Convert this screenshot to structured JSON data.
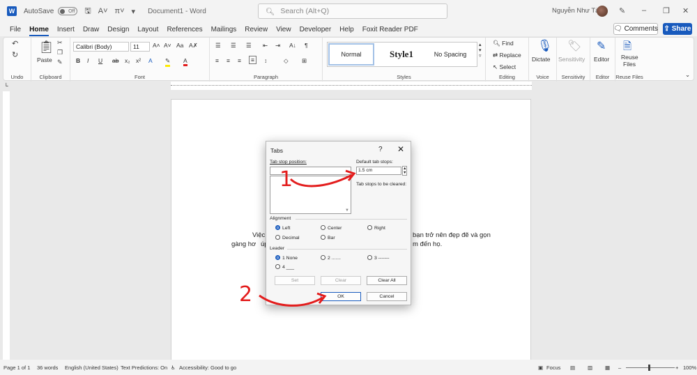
{
  "titlebar": {
    "autosave_label": "AutoSave",
    "autosave_state": "Off",
    "document_title": "Document1 - Word",
    "search_placeholder": "Search (Alt+Q)",
    "user_name": "Nguyễn Như Tài"
  },
  "menu": {
    "tabs": [
      "File",
      "Home",
      "Insert",
      "Draw",
      "Design",
      "Layout",
      "References",
      "Mailings",
      "Review",
      "View",
      "Developer",
      "Help",
      "Foxit Reader PDF"
    ],
    "active_tab": "Home",
    "comments_label": "Comments",
    "share_label": "Share"
  },
  "ribbon": {
    "undo_label": "Undo",
    "clipboard": {
      "paste": "Paste",
      "label": "Clipboard"
    },
    "font": {
      "name": "Calibri (Body)",
      "size": "11",
      "label": "Font"
    },
    "paragraph_label": "Paragraph",
    "styles": {
      "normal": "Normal",
      "style1": "Style1",
      "no_spacing": "No Spacing",
      "label": "Styles"
    },
    "editing": {
      "find": "Find",
      "replace": "Replace",
      "select": "Select",
      "label": "Editing"
    },
    "voice": {
      "dictate": "Dictate",
      "label": "Voice"
    },
    "sensitivity": {
      "button": "Sensitivity",
      "label": "Sensitivity"
    },
    "editor": {
      "button": "Editor",
      "label": "Editor"
    },
    "reuse": {
      "button_line1": "Reuse",
      "button_line2": "Files",
      "label": "Reuse Files"
    }
  },
  "document": {
    "line1_start": "Việc t",
    "line1_end": "bạn trở nên đẹp đẽ và gọn",
    "line2_start": "gàng hơ",
    "line2_mid": "úp",
    "line2_end": "m đến họ."
  },
  "dialog": {
    "title": "Tabs",
    "help": "?",
    "tab_stop_position_label": "Tab stop position:",
    "default_tab_stops_label": "Default tab stops:",
    "default_tab_stops_value": "1.5 cm",
    "to_be_cleared_label": "Tab stops to be cleared:",
    "alignment_label": "Alignment",
    "alignment_options": [
      "Left",
      "Center",
      "Right",
      "Decimal",
      "Bar"
    ],
    "leader_label": "Leader",
    "leader_options": [
      "1 None",
      "2 .......",
      "3 -------",
      "4 ___"
    ],
    "buttons": {
      "set": "Set",
      "clear": "Clear",
      "clear_all": "Clear All",
      "ok": "OK",
      "cancel": "Cancel"
    }
  },
  "annotations": {
    "step1": "1",
    "step2": "2"
  },
  "statusbar": {
    "page": "Page 1 of 1",
    "words": "36 words",
    "language": "English (United States)",
    "text_predictions": "Text Predictions: On",
    "accessibility": "Accessibility: Good to go",
    "focus": "Focus",
    "zoom": "100%"
  },
  "colors": {
    "accent": "#185abd",
    "annotation": "#e31c1c"
  }
}
